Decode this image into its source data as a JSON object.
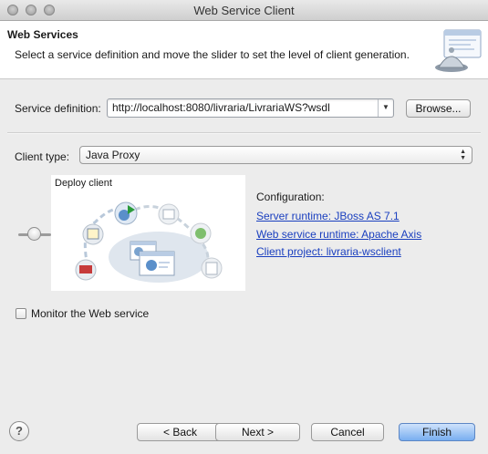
{
  "window": {
    "title": "Web Service Client"
  },
  "banner": {
    "title": "Web Services",
    "description": "Select a service definition and move the slider to set the level of client generation."
  },
  "service_definition": {
    "label": "Service definition:",
    "value": "http://localhost:8080/livraria/LivrariaWS?wsdl",
    "browse_label": "Browse..."
  },
  "client_type": {
    "label": "Client type:",
    "value": "Java Proxy"
  },
  "slider": {
    "level": "Deploy client",
    "value_fraction": 0.35
  },
  "configuration": {
    "title": "Configuration:",
    "server_runtime": "Server runtime: JBoss AS 7.1",
    "ws_runtime": "Web service runtime: Apache Axis",
    "client_project": "Client project: livraria-wsclient"
  },
  "monitor": {
    "label": "Monitor the Web service",
    "checked": false
  },
  "buttons": {
    "back": "< Back",
    "next": "Next >",
    "cancel": "Cancel",
    "finish": "Finish",
    "help": "?"
  },
  "icons": {
    "banner": "web-service-wizard-icon",
    "diagram": "client-generation-diagram"
  }
}
